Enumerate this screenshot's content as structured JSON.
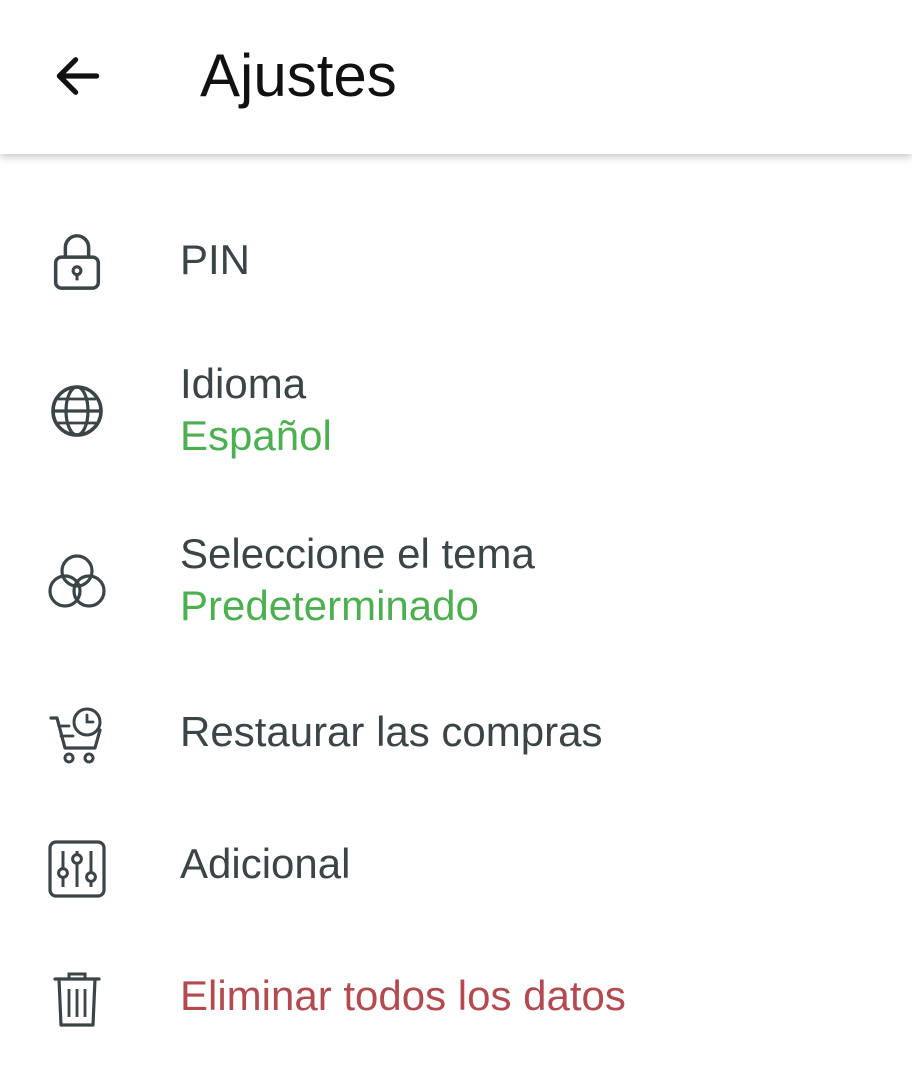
{
  "header": {
    "title": "Ajustes",
    "back_icon": "arrow-left-icon"
  },
  "colors": {
    "text": "#3b4446",
    "accent": "#4caf50",
    "danger": "#b24a4f",
    "icon": "#3b4446"
  },
  "settings": {
    "items": [
      {
        "label": "PIN",
        "icon": "lock-icon"
      },
      {
        "label": "Idioma",
        "value": "Español",
        "icon": "globe-icon"
      },
      {
        "label": "Seleccione el tema",
        "value": "Predeterminado",
        "icon": "theme-circles-icon"
      },
      {
        "label": "Restaurar las compras",
        "icon": "cart-clock-icon"
      },
      {
        "label": "Adicional",
        "icon": "sliders-icon"
      },
      {
        "label": "Eliminar todos los datos",
        "icon": "trash-icon"
      }
    ]
  }
}
